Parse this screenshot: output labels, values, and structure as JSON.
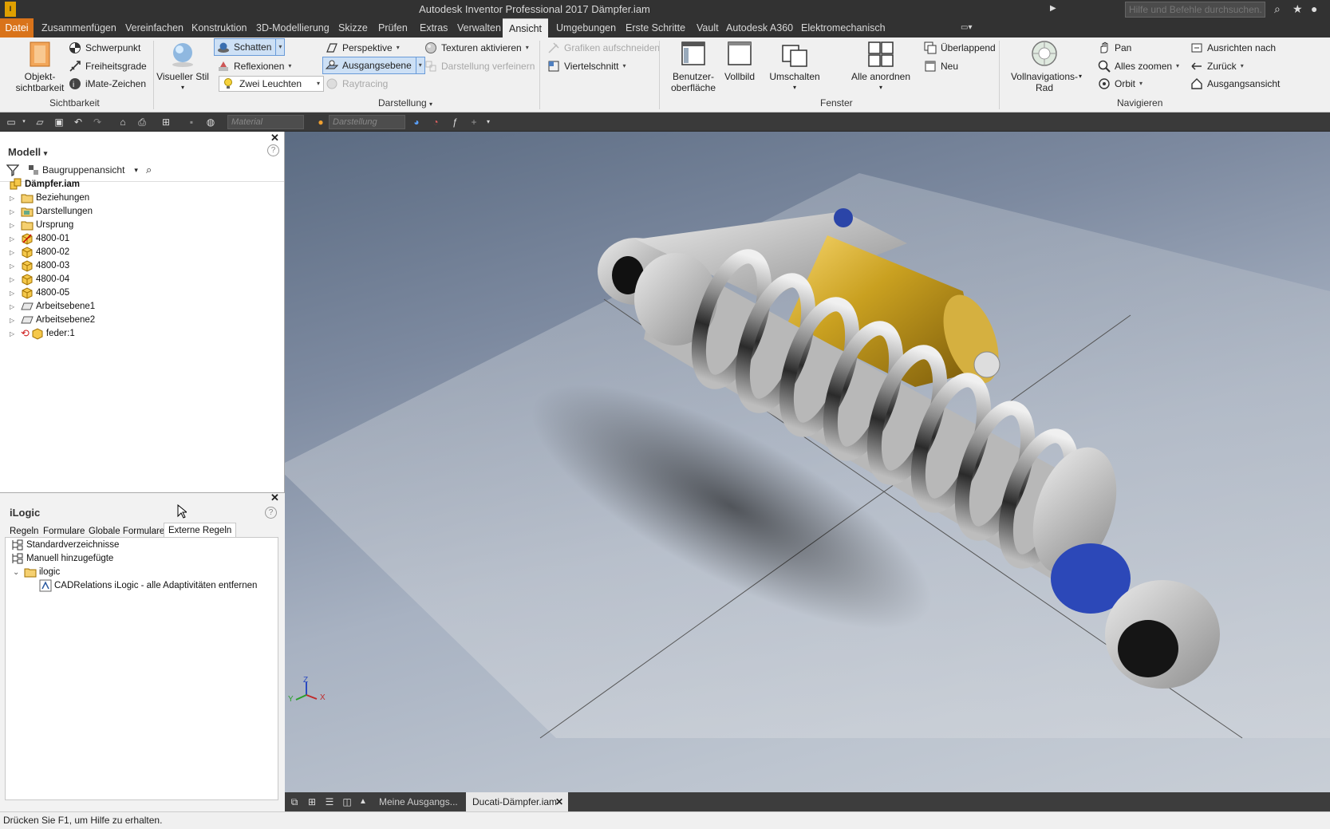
{
  "titlebar": {
    "title": "Autodesk Inventor Professional 2017   Dämpfer.iam",
    "search_placeholder": "Hilfe und Befehle durchsuchen..."
  },
  "menu_tabs": [
    "Datei",
    "Zusammenfügen",
    "Vereinfachen",
    "Konstruktion",
    "3D-Modellierung",
    "Skizze",
    "Prüfen",
    "Extras",
    "Verwalten",
    "Ansicht",
    "Umgebungen",
    "Erste Schritte",
    "Vault",
    "Autodesk A360",
    "Elektromechanisch"
  ],
  "ribbon": {
    "sichtbarkeit": {
      "label": "Sichtbarkeit",
      "objekt_line1": "Objekt-",
      "objekt_line2": "sichtbarkeit",
      "schwerpunkt": "Schwerpunkt",
      "freiheitsgrade": "Freiheitsgrade",
      "imate": "iMate-Zeichen"
    },
    "darstellung": {
      "label": "Darstellung",
      "visueller_stil": "Visueller Stil",
      "schatten": "Schatten",
      "reflexionen": "Reflexionen",
      "zwei_leuchten": "Zwei Leuchten",
      "perspektive": "Perspektive",
      "ausgangsebene": "Ausgangsebene",
      "raytracing": "Raytracing",
      "texturen": "Texturen aktivieren",
      "darstellung_verfeinern": "Darstellung verfeinern",
      "grafiken_aufschneiden": "Grafiken aufschneiden",
      "viertelschnitt": "Viertelschnitt"
    },
    "fenster": {
      "label": "Fenster",
      "benutzer_line1": "Benutzer-",
      "benutzer_line2": "oberfläche",
      "vollbild": "Vollbild",
      "umschalten": "Umschalten",
      "alle_anordnen": "Alle anordnen",
      "ueberlappend": "Überlappend",
      "neu": "Neu"
    },
    "navigieren": {
      "label": "Navigieren",
      "vollnav_line1": "Vollnavigations-",
      "vollnav_line2": "Rad",
      "pan": "Pan",
      "alles_zoomen": "Alles zoomen",
      "orbit": "Orbit",
      "ausrichten": "Ausrichten nach",
      "zurueck": "Zurück",
      "ausgangsansicht": "Ausgangsansicht"
    }
  },
  "qat": {
    "material": "Material",
    "darstellung": "Darstellung"
  },
  "browser": {
    "title": "Modell",
    "view": "Baugruppenansicht",
    "root": "Dämpfer.iam",
    "items": [
      "Beziehungen",
      "Darstellungen",
      "Ursprung",
      "4800-01",
      "4800-02",
      "4800-03",
      "4800-04",
      "4800-05",
      "Arbeitsebene1",
      "Arbeitsebene2",
      "feder:1"
    ]
  },
  "ilogic": {
    "title": "iLogic",
    "tabs": [
      "Regeln",
      "Formulare",
      "Globale Formulare",
      "Externe Regeln"
    ],
    "items": [
      "Standardverzeichnisse",
      "Manuell hinzugefügte",
      "ilogic",
      "CADRelations iLogic - alle Adaptivitäten entfernen"
    ]
  },
  "doctabs": [
    "Meine Ausgangs...",
    "Ducati-Dämpfer.iam"
  ],
  "status": "Drücken Sie F1, um Hilfe zu erhalten.",
  "triad": {
    "x": "X",
    "y": "Y",
    "z": "Z"
  }
}
